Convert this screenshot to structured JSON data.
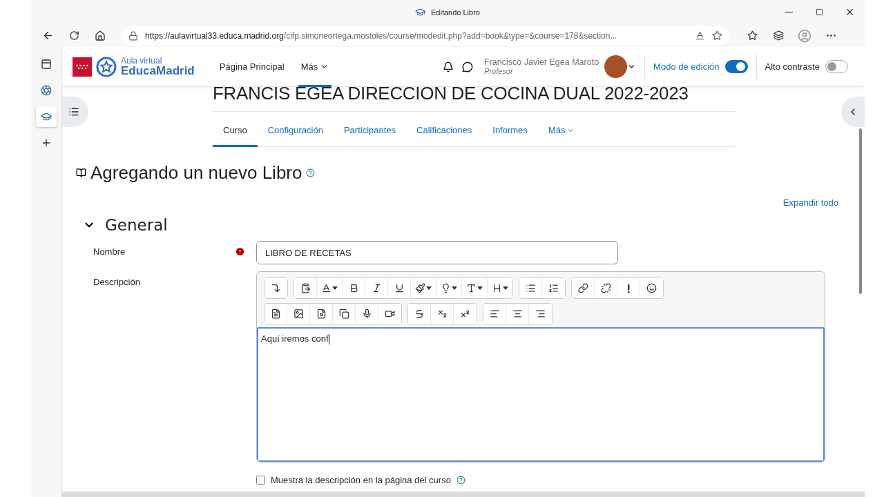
{
  "window": {
    "title": "Editando Libro"
  },
  "address_bar": {
    "host": "https://aulavirtual33.educa.madrid.org",
    "path": "/cifp.simoneortega.mostoles/course/modedit.php?add=book&type=&course=178&section..."
  },
  "site_header": {
    "logo_top": "Aula virtual",
    "logo_bottom": "EducaMadrid",
    "nav": [
      {
        "label": "Página Principal",
        "selected": false,
        "dropdown": false
      },
      {
        "label": "Más",
        "selected": true,
        "dropdown": true
      }
    ],
    "user": {
      "name": "Francisco Javier Egea Maroto",
      "role": "Profesor"
    },
    "toggles": [
      {
        "label": "Modo de edición",
        "on": true
      },
      {
        "label": "Alto contraste",
        "on": false
      }
    ]
  },
  "course_title": "FRANCIS EGEA DIRECCION DE COCINA DUAL 2022-2023",
  "course_tabs": [
    {
      "label": "Curso",
      "selected": true,
      "dropdown": false
    },
    {
      "label": "Configuración",
      "selected": false,
      "dropdown": false
    },
    {
      "label": "Participantes",
      "selected": false,
      "dropdown": false
    },
    {
      "label": "Calificaciones",
      "selected": false,
      "dropdown": false
    },
    {
      "label": "Informes",
      "selected": false,
      "dropdown": false
    },
    {
      "label": "Más",
      "selected": false,
      "dropdown": true
    }
  ],
  "page_title": "Agregando un nuevo Libro",
  "expand_all": "Expandir todo",
  "section": {
    "title": "General",
    "expanded": true
  },
  "fields": {
    "name_label": "Nombre",
    "name_required": true,
    "name_value": "LIBRO DE RECETAS",
    "description_label": "Descripción",
    "description_text": "Aquí iremos conf"
  },
  "show_description": {
    "label": "Muestra la descripción en la página del curso",
    "checked": false
  }
}
